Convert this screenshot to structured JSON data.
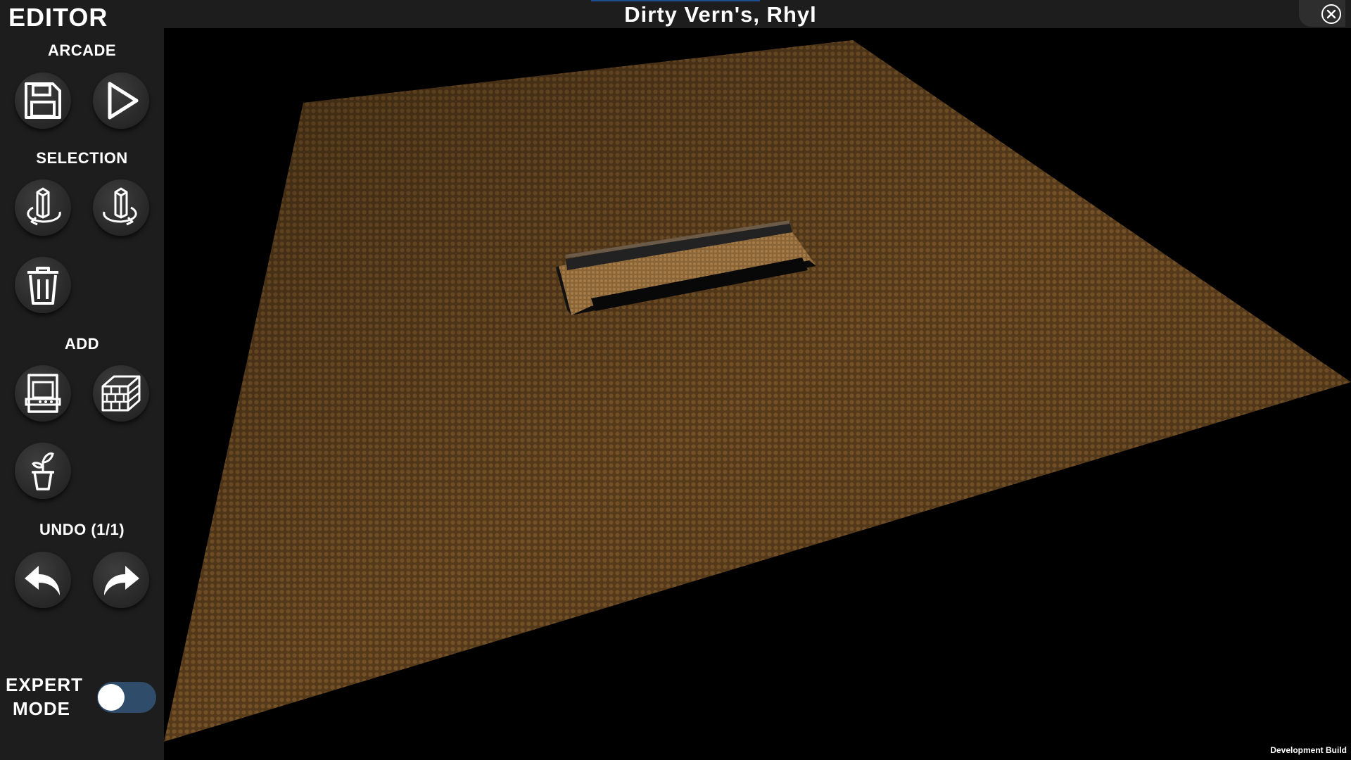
{
  "window": {
    "title": "Dirty Vern's, Rhyl",
    "close_icon": "close-circle-icon"
  },
  "sidebar": {
    "title": "EDITOR",
    "sections": {
      "arcade": {
        "label": "ARCADE",
        "buttons": [
          {
            "name": "save",
            "icon": "floppy-disk-icon"
          },
          {
            "name": "play",
            "icon": "play-icon"
          }
        ]
      },
      "selection": {
        "label": "SELECTION",
        "buttons": [
          {
            "name": "rotate-left",
            "icon": "rotate-left-icon"
          },
          {
            "name": "rotate-right",
            "icon": "rotate-right-icon"
          },
          {
            "name": "delete",
            "icon": "trash-icon"
          }
        ]
      },
      "add": {
        "label": "ADD",
        "buttons": [
          {
            "name": "add-arcade-cabinet",
            "icon": "arcade-cabinet-icon"
          },
          {
            "name": "add-wall",
            "icon": "brick-wall-icon"
          },
          {
            "name": "add-plant",
            "icon": "potted-plant-icon"
          }
        ]
      },
      "undo": {
        "label": "UNDO (1/1)",
        "buttons": [
          {
            "name": "undo",
            "icon": "undo-arrow-icon"
          },
          {
            "name": "redo",
            "icon": "redo-arrow-icon"
          }
        ]
      }
    },
    "expert_mode": {
      "label_line1": "EXPERT",
      "label_line2": "MODE",
      "enabled": false
    }
  },
  "viewport": {
    "floor_color": "#6b4a22",
    "build_label": "Development Build"
  },
  "colors": {
    "panel": "#1d1d1d",
    "toggle_track": "#2f4c6b",
    "accent": "#1e4f91"
  }
}
